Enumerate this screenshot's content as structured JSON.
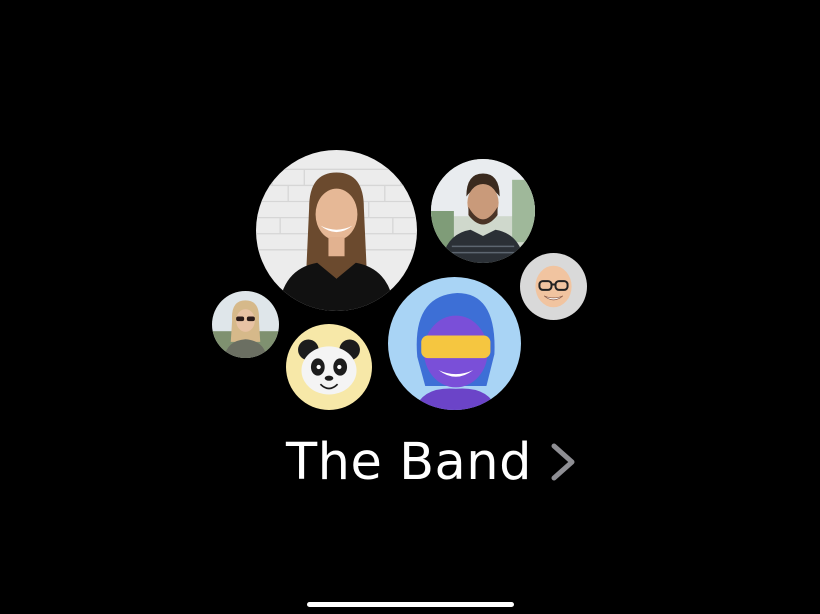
{
  "group": {
    "name": "The Band"
  },
  "avatars": [
    {
      "id": "woman-photo",
      "kind": "photo"
    },
    {
      "id": "man-photo",
      "kind": "photo"
    },
    {
      "id": "bald-memoji",
      "kind": "memoji"
    },
    {
      "id": "blue-hair-memoji",
      "kind": "memoji"
    },
    {
      "id": "panda-animoji",
      "kind": "animoji"
    },
    {
      "id": "sunglasses-photo",
      "kind": "photo"
    }
  ],
  "icons": {
    "disclosure": "chevron-right-icon"
  },
  "colors": {
    "background": "#000000",
    "text": "#ffffff",
    "chevron": "#8e8e93",
    "panda_bg": "#f7e8a8",
    "blue_memoji_bg": "#a9d4f5",
    "bald_memoji_bg": "#d9d9d9"
  }
}
